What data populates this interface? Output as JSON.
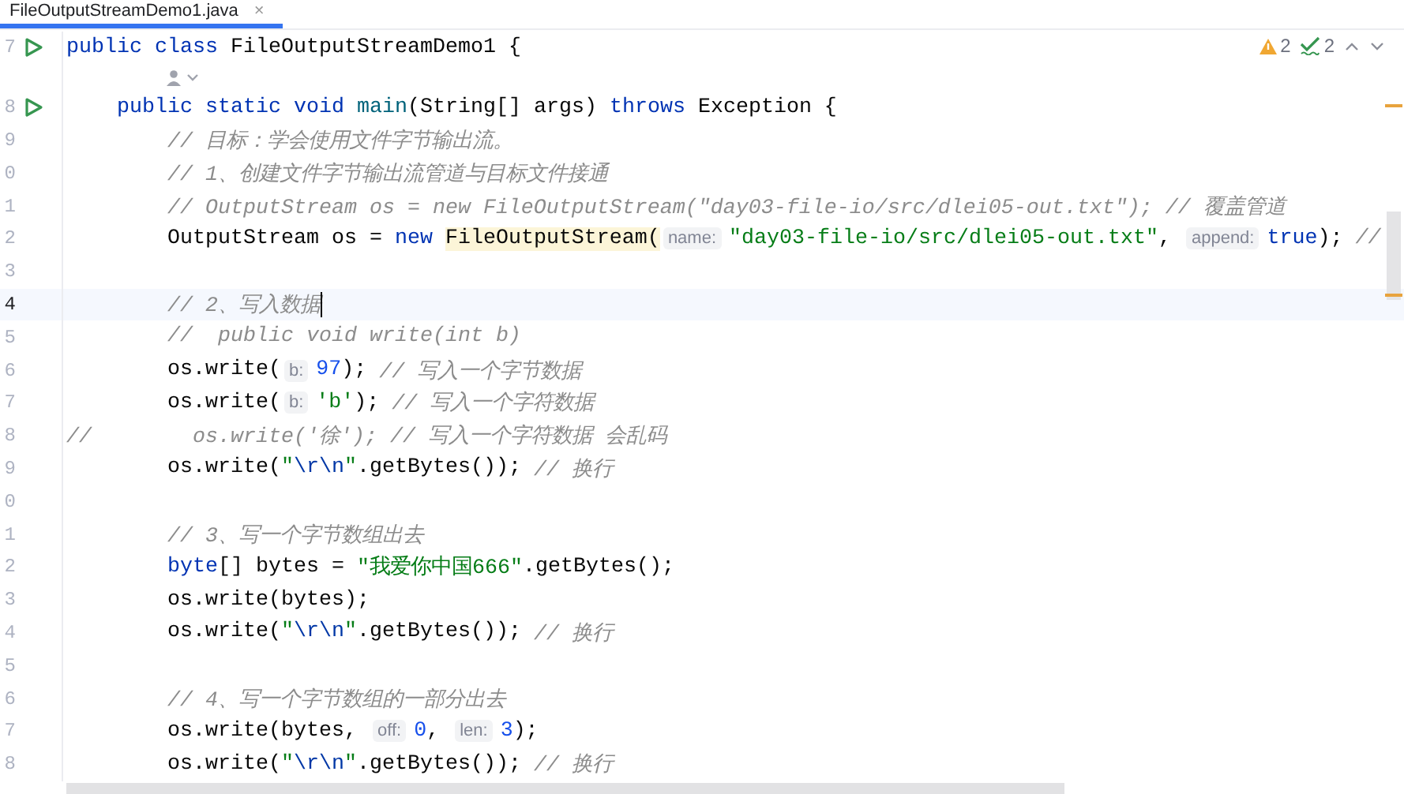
{
  "tabs": [
    {
      "label": "FileOutputStreamDemo1.java",
      "selected": true,
      "close": "×"
    }
  ],
  "inspections": {
    "warnings": "2",
    "weak_warnings": "2"
  },
  "lines": [
    {
      "kind": "code",
      "number": "7",
      "runnable": true,
      "current": false,
      "tokens": [
        {
          "kind": "kw",
          "text": "public class "
        },
        {
          "kind": "plain",
          "text": "FileOutputStreamDemo1 {"
        }
      ]
    },
    {
      "kind": "author_hint"
    },
    {
      "kind": "code",
      "number": "8",
      "runnable": true,
      "current": false,
      "tokens": [
        {
          "kind": "kw",
          "text": "    public static void "
        },
        {
          "kind": "method",
          "text": "main"
        },
        {
          "kind": "plain",
          "text": "(String[] args) "
        },
        {
          "kind": "kw",
          "text": "throws "
        },
        {
          "kind": "plain",
          "text": "Exception {"
        }
      ]
    },
    {
      "kind": "code",
      "number": "9",
      "runnable": false,
      "current": false,
      "tokens": [
        {
          "kind": "cmt",
          "text": "        // 目标：学会使用文件字节输出流。"
        }
      ]
    },
    {
      "kind": "code",
      "number": "0",
      "runnable": false,
      "current": false,
      "tokens": [
        {
          "kind": "cmt",
          "text": "        // 1、创建文件字节输出流管道与目标文件接通"
        }
      ]
    },
    {
      "kind": "code",
      "number": "1",
      "runnable": false,
      "current": false,
      "tokens": [
        {
          "kind": "cmt",
          "text": "        // OutputStream os = new FileOutputStream(\"day03-file-io/src/dlei05-out.txt\"); // 覆盖管道"
        }
      ]
    },
    {
      "kind": "code",
      "number": "2",
      "runnable": false,
      "current": false,
      "tokens": [
        {
          "kind": "plain",
          "text": "        OutputStream os = "
        },
        {
          "kind": "kw",
          "text": "new "
        },
        {
          "kind": "mark",
          "text": "FileOutputStream("
        },
        {
          "kind": "hint",
          "text": "name:"
        },
        {
          "kind": "str",
          "text": "\"day03-file-io/src/dlei05-out.txt\""
        },
        {
          "kind": "plain",
          "text": ", "
        },
        {
          "kind": "hint",
          "text": "append:"
        },
        {
          "kind": "kw",
          "text": "true"
        },
        {
          "kind": "plain",
          "text": "); "
        },
        {
          "kind": "cmt",
          "text": "//"
        }
      ]
    },
    {
      "kind": "blank",
      "number": "3",
      "runnable": false,
      "current": false
    },
    {
      "kind": "code",
      "number": "4",
      "runnable": false,
      "current": true,
      "tokens": [
        {
          "kind": "cmt",
          "text": "        // 2、写入数据"
        }
      ]
    },
    {
      "kind": "code",
      "number": "5",
      "runnable": false,
      "current": false,
      "tokens": [
        {
          "kind": "cmt",
          "text": "        //  public void write(int b)"
        }
      ]
    },
    {
      "kind": "code",
      "number": "6",
      "runnable": false,
      "current": false,
      "tokens": [
        {
          "kind": "plain",
          "text": "        os.write("
        },
        {
          "kind": "hint",
          "text": "b:"
        },
        {
          "kind": "num",
          "text": "97"
        },
        {
          "kind": "plain",
          "text": "); "
        },
        {
          "kind": "cmt",
          "text": "// 写入一个字节数据"
        }
      ]
    },
    {
      "kind": "code",
      "number": "7",
      "runnable": false,
      "current": false,
      "tokens": [
        {
          "kind": "plain",
          "text": "        os.write("
        },
        {
          "kind": "hint",
          "text": "b:"
        },
        {
          "kind": "str",
          "text": "'b'"
        },
        {
          "kind": "plain",
          "text": "); "
        },
        {
          "kind": "cmt",
          "text": "// 写入一个字符数据"
        }
      ]
    },
    {
      "kind": "code",
      "number": "8",
      "runnable": false,
      "current": false,
      "tokens": [
        {
          "kind": "cmt",
          "text": "//        os.write('徐'); // 写入一个字符数据 会乱码"
        }
      ]
    },
    {
      "kind": "code",
      "number": "9",
      "runnable": false,
      "current": false,
      "tokens": [
        {
          "kind": "plain",
          "text": "        os.write("
        },
        {
          "kind": "str",
          "text": "\""
        },
        {
          "kind": "esc",
          "text": "\\r\\n"
        },
        {
          "kind": "str",
          "text": "\""
        },
        {
          "kind": "plain",
          "text": ".getBytes()); "
        },
        {
          "kind": "cmt",
          "text": "// 换行"
        }
      ]
    },
    {
      "kind": "blank",
      "number": "0",
      "runnable": false,
      "current": false
    },
    {
      "kind": "code",
      "number": "1",
      "runnable": false,
      "current": false,
      "tokens": [
        {
          "kind": "cmt",
          "text": "        // 3、写一个字节数组出去"
        }
      ]
    },
    {
      "kind": "code",
      "number": "2",
      "runnable": false,
      "current": false,
      "tokens": [
        {
          "kind": "kw",
          "text": "        byte"
        },
        {
          "kind": "plain",
          "text": "[] bytes = "
        },
        {
          "kind": "str",
          "text": "\"我爱你中国666\""
        },
        {
          "kind": "plain",
          "text": ".getBytes();"
        }
      ]
    },
    {
      "kind": "code",
      "number": "3",
      "runnable": false,
      "current": false,
      "tokens": [
        {
          "kind": "plain",
          "text": "        os.write(bytes);"
        }
      ]
    },
    {
      "kind": "code",
      "number": "4",
      "runnable": false,
      "current": false,
      "tokens": [
        {
          "kind": "plain",
          "text": "        os.write("
        },
        {
          "kind": "str",
          "text": "\""
        },
        {
          "kind": "esc",
          "text": "\\r\\n"
        },
        {
          "kind": "str",
          "text": "\""
        },
        {
          "kind": "plain",
          "text": ".getBytes()); "
        },
        {
          "kind": "cmt",
          "text": "// 换行"
        }
      ]
    },
    {
      "kind": "blank",
      "number": "5",
      "runnable": false,
      "current": false
    },
    {
      "kind": "code",
      "number": "6",
      "runnable": false,
      "current": false,
      "tokens": [
        {
          "kind": "cmt",
          "text": "        // 4、写一个字节数组的一部分出去"
        }
      ]
    },
    {
      "kind": "code",
      "number": "7",
      "runnable": false,
      "current": false,
      "tokens": [
        {
          "kind": "plain",
          "text": "        os.write(bytes, "
        },
        {
          "kind": "hint",
          "text": "off:"
        },
        {
          "kind": "num",
          "text": "0"
        },
        {
          "kind": "plain",
          "text": ", "
        },
        {
          "kind": "hint",
          "text": "len:"
        },
        {
          "kind": "num",
          "text": "3"
        },
        {
          "kind": "plain",
          "text": ");"
        }
      ]
    },
    {
      "kind": "code",
      "number": "8",
      "runnable": false,
      "current": false,
      "tokens": [
        {
          "kind": "plain",
          "text": "        os.write("
        },
        {
          "kind": "str",
          "text": "\""
        },
        {
          "kind": "esc",
          "text": "\\r\\n"
        },
        {
          "kind": "str",
          "text": "\""
        },
        {
          "kind": "plain",
          "text": ".getBytes()); "
        },
        {
          "kind": "cmt",
          "text": "// 换行"
        }
      ]
    }
  ]
}
